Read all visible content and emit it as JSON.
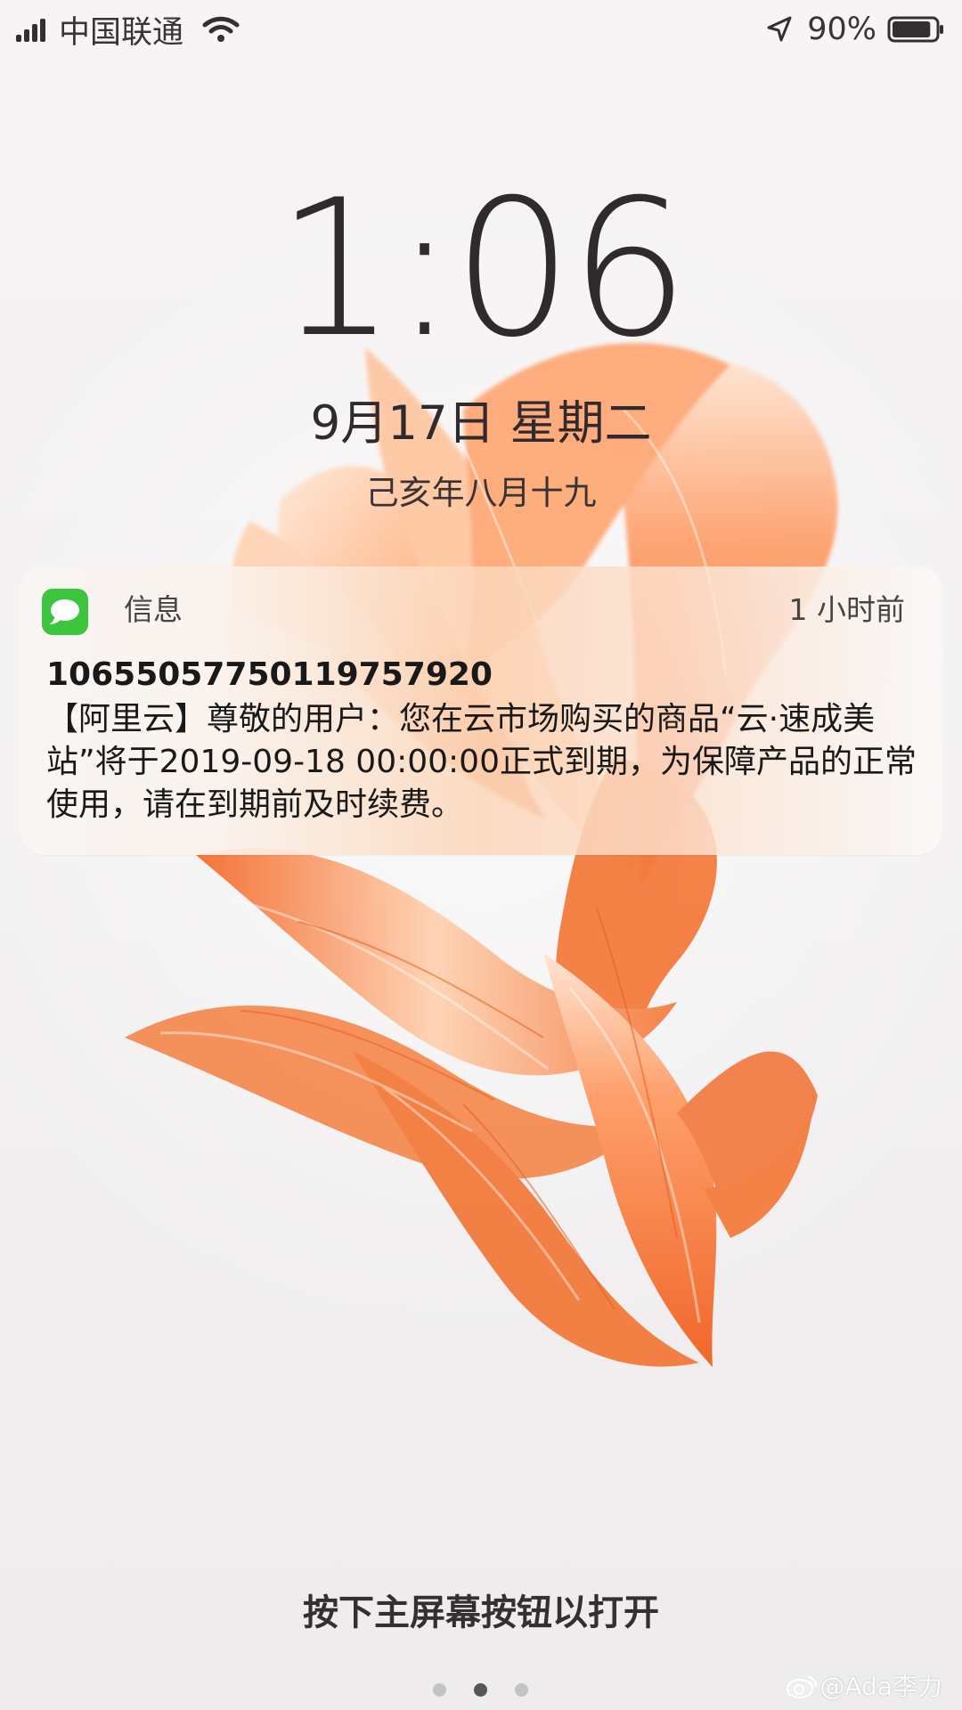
{
  "status_bar": {
    "carrier": "中国联通",
    "battery_percent": "90%",
    "battery_level": 0.9,
    "icons": [
      "signal-bars-icon",
      "wifi-icon",
      "location-arrow-icon",
      "battery-icon"
    ]
  },
  "lock_screen": {
    "time": "1:06",
    "date": "9月17日 星期二",
    "lunar_date": "己亥年八月十九"
  },
  "notification": {
    "app_name": "信息",
    "relative_time": "1 小时前",
    "sender": "10655057750119757920",
    "message": "【阿里云】尊敬的用户：您在云市场购买的商品“云·速成美站”将于2019-09-18 00:00:00正式到期，为保障产品的正常使用，请在到期前及时续费。",
    "app_icon": "messages-app-icon",
    "accent_color": "#3cc63d"
  },
  "footer": {
    "hint": "按下主屏幕按钮以打开",
    "page_count": 3,
    "current_page": 2
  },
  "watermark": {
    "text": "@Ada李力",
    "icon": "weibo-icon"
  },
  "colors": {
    "wallpaper": "#f1eff0",
    "fish_orange": "#f37a3b",
    "text_dark": "#302a2d"
  }
}
